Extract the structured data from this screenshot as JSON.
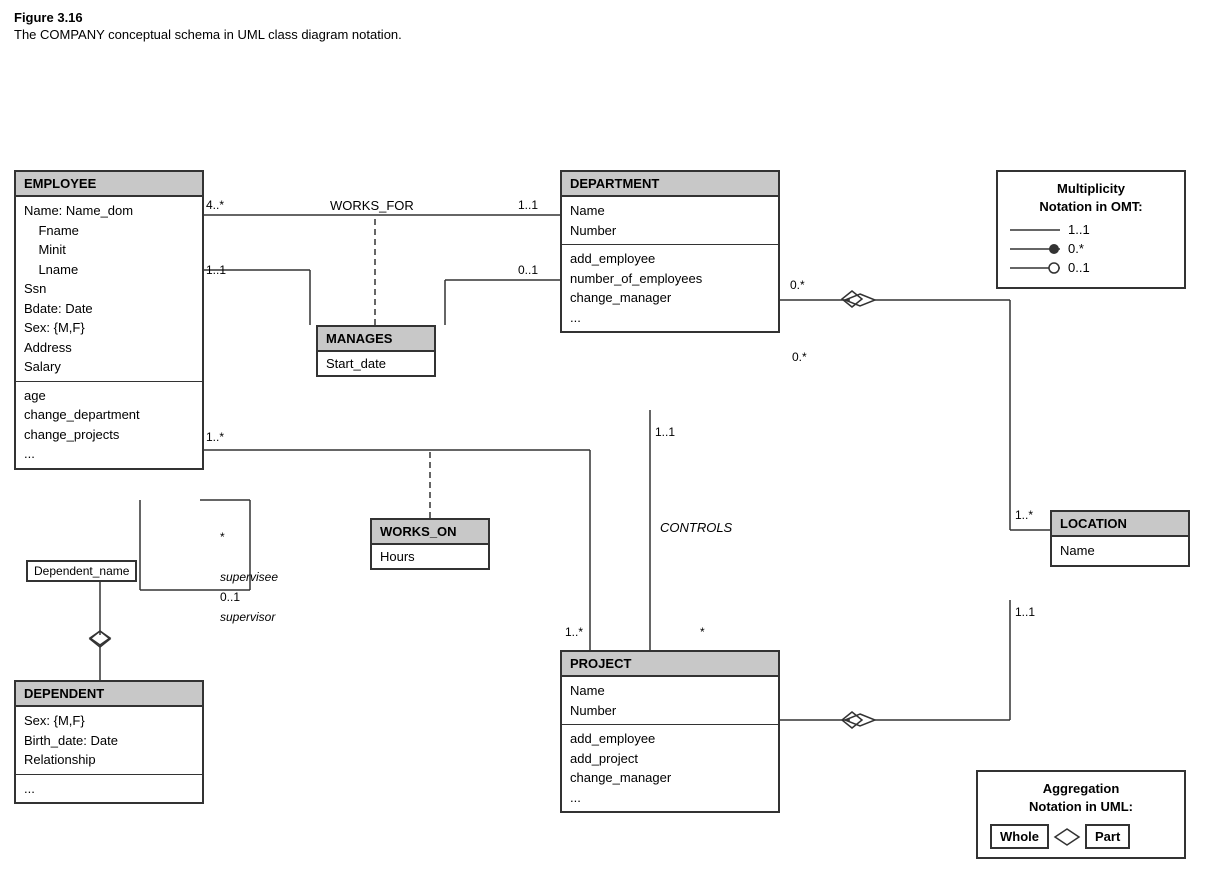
{
  "figure": {
    "title": "Figure 3.16",
    "caption": "The COMPANY conceptual schema in UML class diagram notation."
  },
  "classes": {
    "employee": {
      "header": "EMPLOYEE",
      "attributes": [
        "Name: Name_dom",
        "    Fname",
        "    Minit",
        "    Lname",
        "Ssn",
        "Bdate: Date",
        "Sex: {M,F}",
        "Address",
        "Salary"
      ],
      "methods": [
        "age",
        "change_department",
        "change_projects",
        "..."
      ]
    },
    "department": {
      "header": "DEPARTMENT",
      "attributes": [
        "Name",
        "Number"
      ],
      "methods": [
        "add_employee",
        "number_of_employees",
        "change_manager",
        "..."
      ]
    },
    "project": {
      "header": "PROJECT",
      "attributes": [
        "Name",
        "Number"
      ],
      "methods": [
        "add_employee",
        "add_project",
        "change_manager",
        "..."
      ]
    },
    "dependent": {
      "header": "DEPENDENT",
      "attributes": [
        "Sex: {M,F}",
        "Birth_date: Date",
        "Relationship"
      ],
      "methods": [
        "..."
      ]
    },
    "location": {
      "header": "LOCATION",
      "attributes": [
        "Name"
      ],
      "methods": []
    }
  },
  "assoc_classes": {
    "manages": {
      "header": "MANAGES",
      "body": "Start_date"
    },
    "works_on": {
      "header": "WORKS_ON",
      "body": "Hours"
    }
  },
  "relationships": {
    "works_for": "WORKS_FOR",
    "controls": "CONTROLS"
  },
  "multiplicities": {
    "works_for_emp": "4..*",
    "works_for_dept": "1..1",
    "manages_emp": "1..1",
    "manages_dept": "0..1",
    "supervises_sup": "1..*",
    "supervises_sub": "*",
    "supervisee_label": "supervisee",
    "supervisor_label": "0..1",
    "supervisor_role": "supervisor",
    "dept_project": "1..1",
    "dept_loc": "0.*",
    "project_emp": "1..*",
    "project_agg": "*",
    "loc_dept": "1..*",
    "loc_proj": "1..1",
    "dep_agg": "0.*"
  },
  "legend": {
    "title": "Multiplicity\nNotation in OMT:",
    "rows": [
      {
        "symbol": "line",
        "label": "1..1"
      },
      {
        "symbol": "filled-circle",
        "label": "0.*"
      },
      {
        "symbol": "open-circle",
        "label": "0..1"
      }
    ]
  },
  "aggregation_note": {
    "title": "Aggregation\nNotation in UML:",
    "whole_label": "Whole",
    "part_label": "Part"
  },
  "small_box": {
    "label": "Dependent_name"
  }
}
